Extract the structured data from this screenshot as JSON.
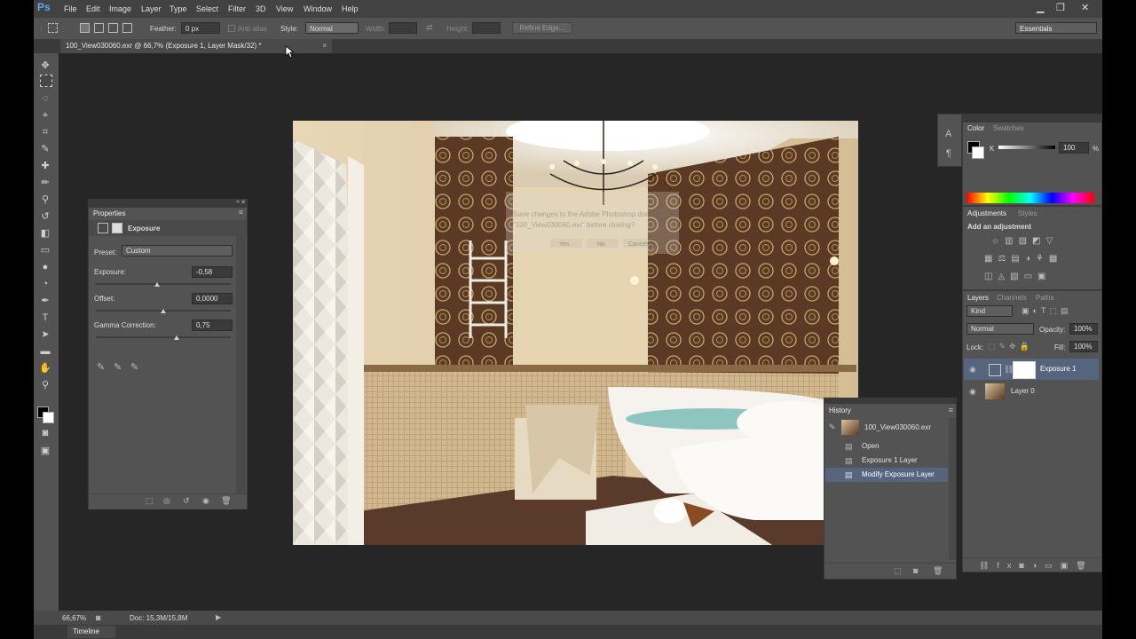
{
  "app": {
    "logo": "Ps",
    "menu": [
      "File",
      "Edit",
      "Image",
      "Layer",
      "Type",
      "Select",
      "Filter",
      "3D",
      "View",
      "Window",
      "Help"
    ],
    "window_controls": [
      "▁",
      "❐",
      "✕"
    ]
  },
  "options": {
    "feather_label": "Feather:",
    "feather_value": "0 px",
    "antialias_label": "Anti-alias",
    "style_label": "Style:",
    "style_value": "Normal",
    "width_label": "Width:",
    "height_label": "Height:",
    "refine_edge": "Refine Edge...",
    "workspace": "Essentials"
  },
  "document_tab": {
    "title": "100_View030060.exr @ 66,7% (Exposure 1, Layer Mask/32) *",
    "close": "×"
  },
  "dialog_ghost": {
    "line1": "Save changes to the Adobe Photoshop document",
    "line2": "\"100_View030060.exr\" before closing?",
    "yes": "Yes",
    "no": "No",
    "cancel": "Cancel"
  },
  "properties": {
    "tab": "Properties",
    "title": "Exposure",
    "preset_label": "Preset:",
    "preset_value": "Custom",
    "exposure_label": "Exposure:",
    "exposure_value": "-0,58",
    "offset_label": "Offset:",
    "offset_value": "0,0000",
    "gamma_label": "Gamma Correction:",
    "gamma_value": "0,75"
  },
  "color_panel": {
    "tabs": [
      "Color",
      "Swatches"
    ],
    "channel": "K",
    "value": "100",
    "unit": "%"
  },
  "adjustments": {
    "tabs": [
      "Adjustments",
      "Styles"
    ],
    "heading": "Add an adjustment"
  },
  "layers": {
    "tabs": [
      "Layers",
      "Channels",
      "Paths"
    ],
    "kind_label": "Kind",
    "blend_mode": "Normal",
    "opacity_label": "Opacity:",
    "opacity_value": "100%",
    "lock_label": "Lock:",
    "fill_label": "Fill:",
    "fill_value": "100%",
    "items": [
      {
        "name": "Exposure 1",
        "selected": true
      },
      {
        "name": "Layer 0",
        "selected": false
      }
    ]
  },
  "history": {
    "tab": "History",
    "snapshot": "100_View030060.exr",
    "items": [
      {
        "name": "Open",
        "selected": false
      },
      {
        "name": "Exposure 1 Layer",
        "selected": false
      },
      {
        "name": "Modify Exposure Layer",
        "selected": true
      }
    ]
  },
  "status": {
    "zoom": "66,67%",
    "doc": "Doc: 15,3M/15,8M"
  },
  "timeline": {
    "label": "Timeline"
  },
  "colors": {
    "panel": "#535353",
    "canvas": "#262626",
    "selection": "#56657e",
    "accent": "#5aa9f0"
  }
}
